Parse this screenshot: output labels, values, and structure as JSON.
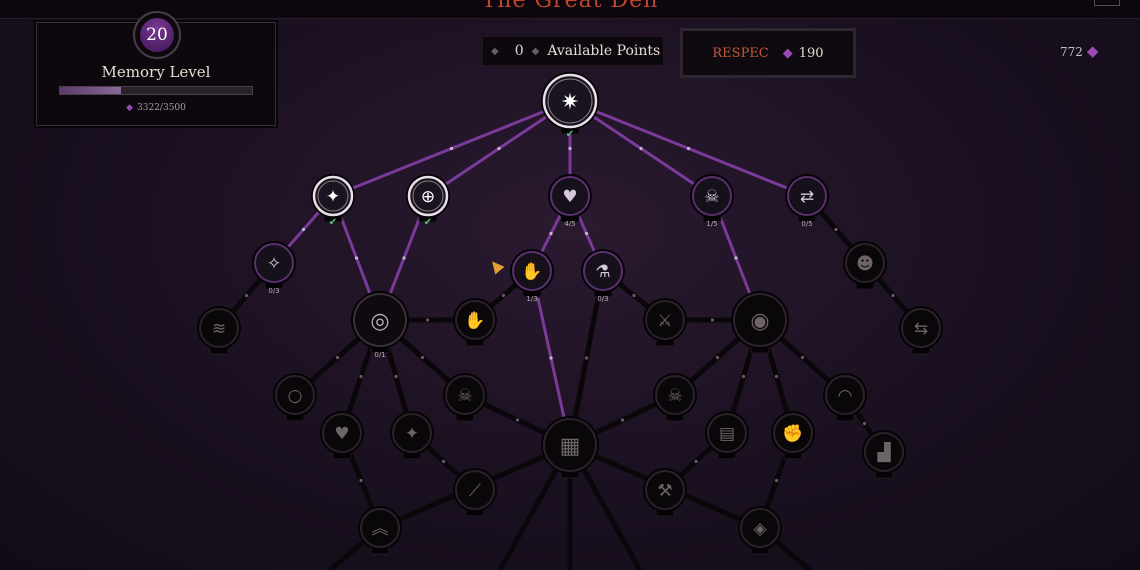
{
  "header": {
    "title": "The Great Den"
  },
  "memory": {
    "level": "20",
    "label": "Memory Level",
    "xp_text": "3322/3500",
    "xp_fraction": 0.32,
    "gem_icon": "purple-gem-icon"
  },
  "points": {
    "value": "0",
    "label": "Available Points"
  },
  "respec": {
    "label": "RESPEC",
    "cost": "190",
    "gem_icon": "purple-gem-icon"
  },
  "currency": {
    "amount": "772",
    "gem_icon": "purple-gem-icon"
  },
  "colors": {
    "active_edge": "#7a3a98",
    "inactive_edge": "#0a070b",
    "accent_text": "#c05a3a",
    "check": "#57c27a"
  },
  "nodes": [
    {
      "id": "root",
      "icon": "compass-star-icon",
      "state": "unlocked",
      "badge": "check"
    },
    {
      "id": "a1",
      "icon": "spark-claw-icon",
      "state": "unlocked",
      "badge": "check"
    },
    {
      "id": "a2",
      "icon": "globe-shield-icon",
      "state": "unlocked",
      "badge": "check"
    },
    {
      "id": "a3",
      "icon": "heart-potion-icon",
      "state": "partial",
      "rank": "4/5"
    },
    {
      "id": "a4",
      "icon": "skull-up-icon",
      "state": "partial",
      "rank": "1/5"
    },
    {
      "id": "a5",
      "icon": "bag-swap-icon",
      "state": "partial",
      "rank": "0/5"
    },
    {
      "id": "b1",
      "icon": "sparkles-icon",
      "state": "partial",
      "rank": "0/3"
    },
    {
      "id": "b2",
      "icon": "hand-potion-icon",
      "state": "partial",
      "rank": "1/3"
    },
    {
      "id": "b3",
      "icon": "flask-arrow-icon",
      "state": "partial",
      "rank": "0/3"
    },
    {
      "id": "b4",
      "icon": "bust-icon",
      "state": "locked"
    },
    {
      "id": "c1",
      "icon": "claw-slash-icon",
      "state": "locked"
    },
    {
      "id": "c2",
      "icon": "ring-sparkle-icon",
      "state": "available",
      "rank": "0/1"
    },
    {
      "id": "c3",
      "icon": "hand-bottle-icon",
      "state": "locked"
    },
    {
      "id": "c4",
      "icon": "sword-arc-icon",
      "state": "locked"
    },
    {
      "id": "c5",
      "icon": "eye-ring-icon",
      "state": "locked"
    },
    {
      "id": "c6",
      "icon": "hands-swap-icon",
      "state": "locked"
    },
    {
      "id": "d1",
      "icon": "ring-icon",
      "state": "locked"
    },
    {
      "id": "d2",
      "icon": "skull-arrow-icon",
      "state": "locked"
    },
    {
      "id": "d3",
      "icon": "skull-up-icon",
      "state": "locked"
    },
    {
      "id": "d4",
      "icon": "bow-icon",
      "state": "locked"
    },
    {
      "id": "e1",
      "icon": "heart-icon",
      "state": "locked"
    },
    {
      "id": "e2",
      "icon": "sparkle-icon",
      "state": "locked"
    },
    {
      "id": "e3",
      "icon": "grid-core-icon",
      "state": "locked"
    },
    {
      "id": "e4",
      "icon": "book-icon",
      "state": "locked"
    },
    {
      "id": "e5",
      "icon": "fist-icon",
      "state": "locked"
    },
    {
      "id": "e6",
      "icon": "boot-icon",
      "state": "locked"
    },
    {
      "id": "f1",
      "icon": "slash-icon",
      "state": "locked"
    },
    {
      "id": "f2",
      "icon": "axe-icon",
      "state": "locked"
    },
    {
      "id": "g1",
      "icon": "chevrons-up-icon",
      "state": "locked"
    },
    {
      "id": "g2",
      "icon": "orb-icon",
      "state": "locked"
    }
  ]
}
